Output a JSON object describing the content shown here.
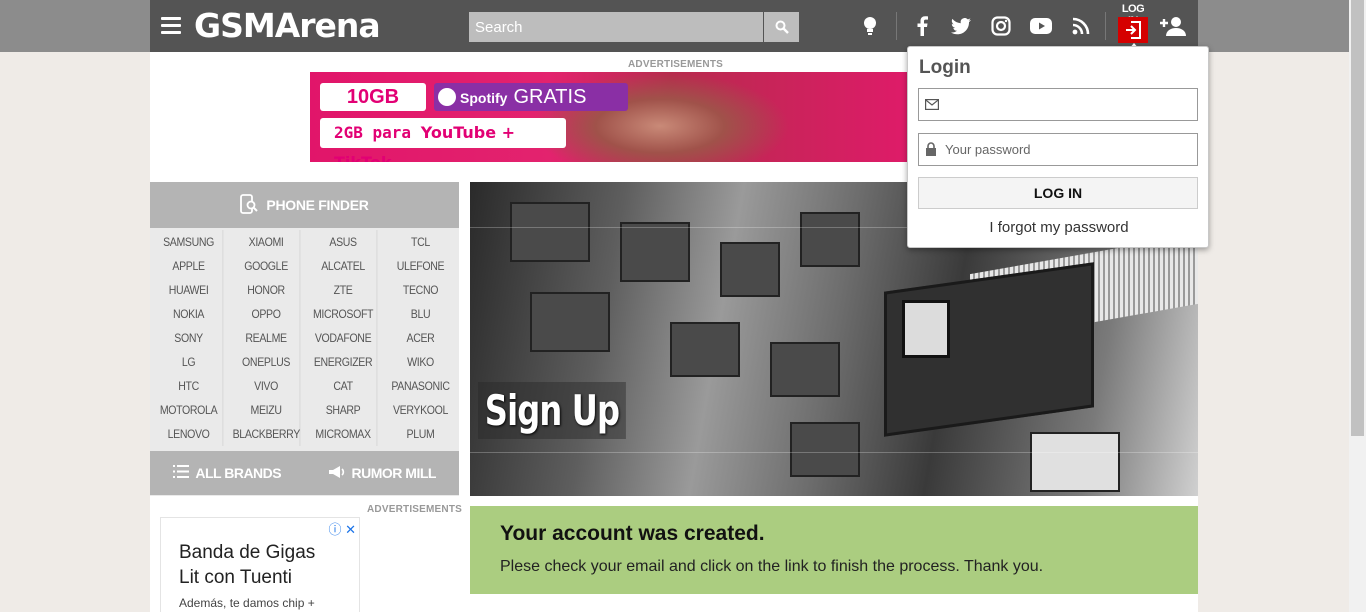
{
  "header": {
    "logo": "GSMArena",
    "search_placeholder": "Search",
    "login_tab_label": "LOG IN"
  },
  "ads": {
    "label": "ADVERTISEMENTS",
    "banner": {
      "pill1": "10GB",
      "pill2_brand": "Spotify",
      "pill2_text": "GRATIS",
      "pill3_prefix": "2GB para",
      "pill3_apps": "YouTube + TikTok"
    },
    "side_ad": {
      "title": "Banda de Gigas Lit con Tuenti",
      "subtitle": "Además, te damos chip +"
    }
  },
  "finder": {
    "title": "PHONE FINDER",
    "brands": [
      "SAMSUNG",
      "XIAOMI",
      "ASUS",
      "TCL",
      "APPLE",
      "GOOGLE",
      "ALCATEL",
      "ULEFONE",
      "HUAWEI",
      "HONOR",
      "ZTE",
      "TECNO",
      "NOKIA",
      "OPPO",
      "MICROSOFT",
      "BLU",
      "SONY",
      "REALME",
      "VODAFONE",
      "ACER",
      "LG",
      "ONEPLUS",
      "ENERGIZER",
      "WIKO",
      "HTC",
      "VIVO",
      "CAT",
      "PANASONIC",
      "MOTOROLA",
      "MEIZU",
      "SHARP",
      "VERYKOOL",
      "LENOVO",
      "BLACKBERRY",
      "MICROMAX",
      "PLUM"
    ],
    "all_brands": "ALL BRANDS",
    "rumor_mill": "RUMOR MILL"
  },
  "hero": {
    "title": "Sign Up"
  },
  "success": {
    "title": "Your account was created.",
    "message": "Plese check your email and click on the link to finish the process. Thank you."
  },
  "login": {
    "title": "Login",
    "email_placeholder": "",
    "password_placeholder": "Your password",
    "button": "LOG IN",
    "forgot": "I forgot my password"
  },
  "colors": {
    "header_bg": "#545454",
    "login_red": "#d50000",
    "success_bg": "#abcd80",
    "finder_bg": "#b4b4b4"
  }
}
